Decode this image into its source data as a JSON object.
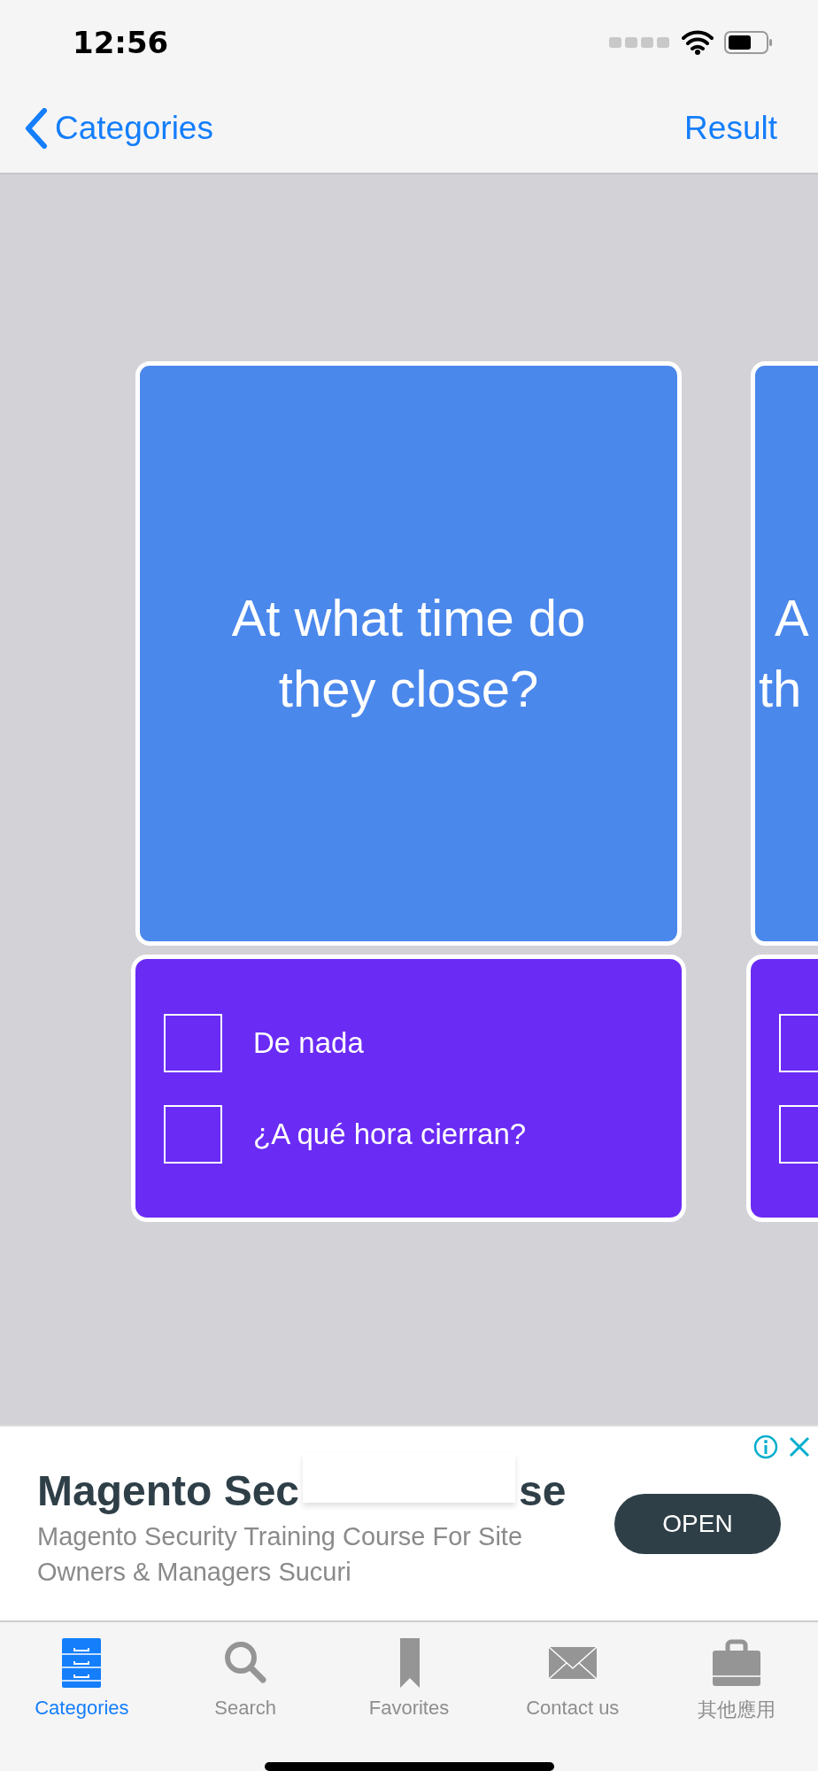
{
  "status_bar": {
    "time": "12:56"
  },
  "nav": {
    "back_label": "Categories",
    "action": "Result"
  },
  "cards": [
    {
      "kind": "full",
      "question_lines": [
        "At what time do",
        "they close?"
      ],
      "options": [
        {
          "label": "De nada",
          "checked": false
        },
        {
          "label": "¿A qué hora cierran?",
          "checked": false
        }
      ]
    },
    {
      "kind": "partial",
      "question_lines": [
        "A",
        "th"
      ],
      "options": [
        {
          "checked": false
        },
        {
          "checked": false
        }
      ]
    }
  ],
  "ad": {
    "title_parts": [
      "Magento Sec",
      "se"
    ],
    "description": "Magento Security Training Course For Site Owners & Managers Sucuri",
    "button": "OPEN"
  },
  "tabs": [
    {
      "label": "Categories",
      "kind": "drawers",
      "selected": true
    },
    {
      "label": "Search",
      "kind": "search",
      "selected": false
    },
    {
      "label": "Favorites",
      "kind": "bookmark",
      "selected": false
    },
    {
      "label": "Contact us",
      "kind": "mail",
      "selected": false
    },
    {
      "label": "其他應用",
      "kind": "bag",
      "selected": false
    }
  ]
}
